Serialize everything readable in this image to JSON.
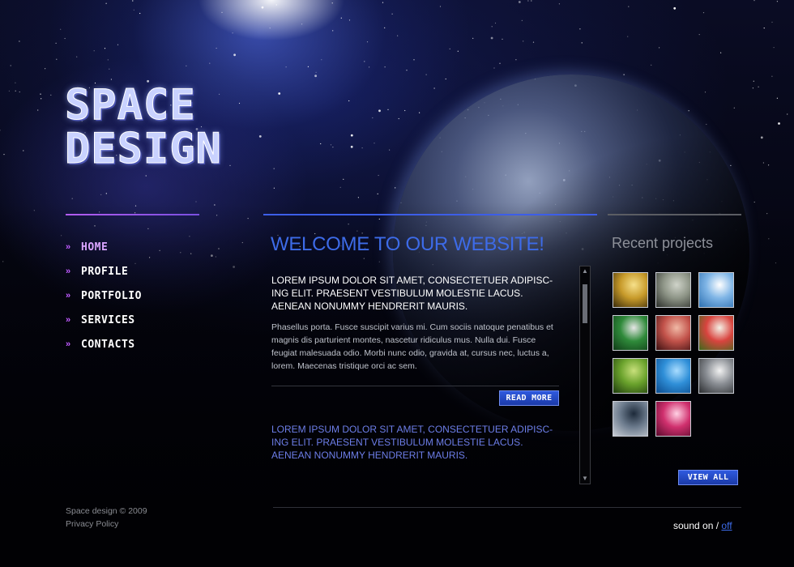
{
  "logo": {
    "line1": "SPACE",
    "line2": "DESIGN"
  },
  "nav": [
    {
      "label": "HOME",
      "active": true
    },
    {
      "label": "PROFILE",
      "active": false
    },
    {
      "label": "PORTFOLIO",
      "active": false
    },
    {
      "label": "SERVICES",
      "active": false
    },
    {
      "label": "CONTACTS",
      "active": false
    }
  ],
  "nav_arrow": "»",
  "main": {
    "title": "WELCOME TO OUR WEBSITE!",
    "lead": "LOREM IPSUM DOLOR SIT AMET, CONSECTETUER ADIPISC-ING ELIT. PRAESENT VESTIBULUM MOLESTIE LACUS. AENEAN NONUMMY HENDRERIT MAURIS.",
    "body": "Phasellus porta. Fusce suscipit varius mi. Cum sociis natoque penatibus et magnis dis parturient montes, nascetur ridiculus mus. Nulla dui. Fusce feugiat malesuada odio. Morbi nunc odio, gravida at, cursus nec, luctus a, lorem. Maecenas tristique orci ac sem.",
    "read_more": "READ MORE",
    "highlight": "LOREM IPSUM DOLOR SIT AMET, CONSECTETUER ADIPISC-ING ELIT. PRAESENT VESTIBULUM MOLESTIE LACUS. AENEAN NONUMMY HENDRERIT MAURIS."
  },
  "recent": {
    "title": "Recent projects",
    "thumbnails": [
      {
        "name": "gold-abstract",
        "colors": [
          "#3a2a08",
          "#c79a2a",
          "#f6e08a"
        ]
      },
      {
        "name": "eye",
        "colors": [
          "#2b2e2a",
          "#8d9486",
          "#cfd3c9"
        ]
      },
      {
        "name": "sky-light",
        "colors": [
          "#2c6fb0",
          "#7fb5e6",
          "#ffffff"
        ]
      },
      {
        "name": "billiard-ball",
        "colors": [
          "#0f3b17",
          "#2f8a3a",
          "#e6e6e6"
        ]
      },
      {
        "name": "hand-red",
        "colors": [
          "#3a0f10",
          "#c2524a",
          "#f0b9a6"
        ]
      },
      {
        "name": "watermelon",
        "colors": [
          "#3d6a1a",
          "#d9443f",
          "#f4f1e6"
        ]
      },
      {
        "name": "green-fruit",
        "colors": [
          "#1d3a0c",
          "#6aa22c",
          "#c8e07b"
        ]
      },
      {
        "name": "blue-water",
        "colors": [
          "#0b4a8c",
          "#2f8fd8",
          "#a8dcff"
        ]
      },
      {
        "name": "white-flower",
        "colors": [
          "#2a2c2f",
          "#8a8e94",
          "#f2f2f2"
        ]
      },
      {
        "name": "credit-card",
        "colors": [
          "#c9ced6",
          "#6b7a8c",
          "#1d2a3a"
        ]
      },
      {
        "name": "pink-abstract",
        "colors": [
          "#5a0a2c",
          "#d0306e",
          "#ffd1e4"
        ]
      }
    ],
    "view_all": "VIEW ALL"
  },
  "footer": {
    "copyright": "Space design © 2009",
    "privacy": "Privacy Policy",
    "sound_on": "sound on",
    "sound_sep": "/",
    "sound_off": "off"
  },
  "colors": {
    "accent_blue": "#3d6be8",
    "accent_purple": "#c05cff",
    "nav_active": "#d9a4ff"
  }
}
